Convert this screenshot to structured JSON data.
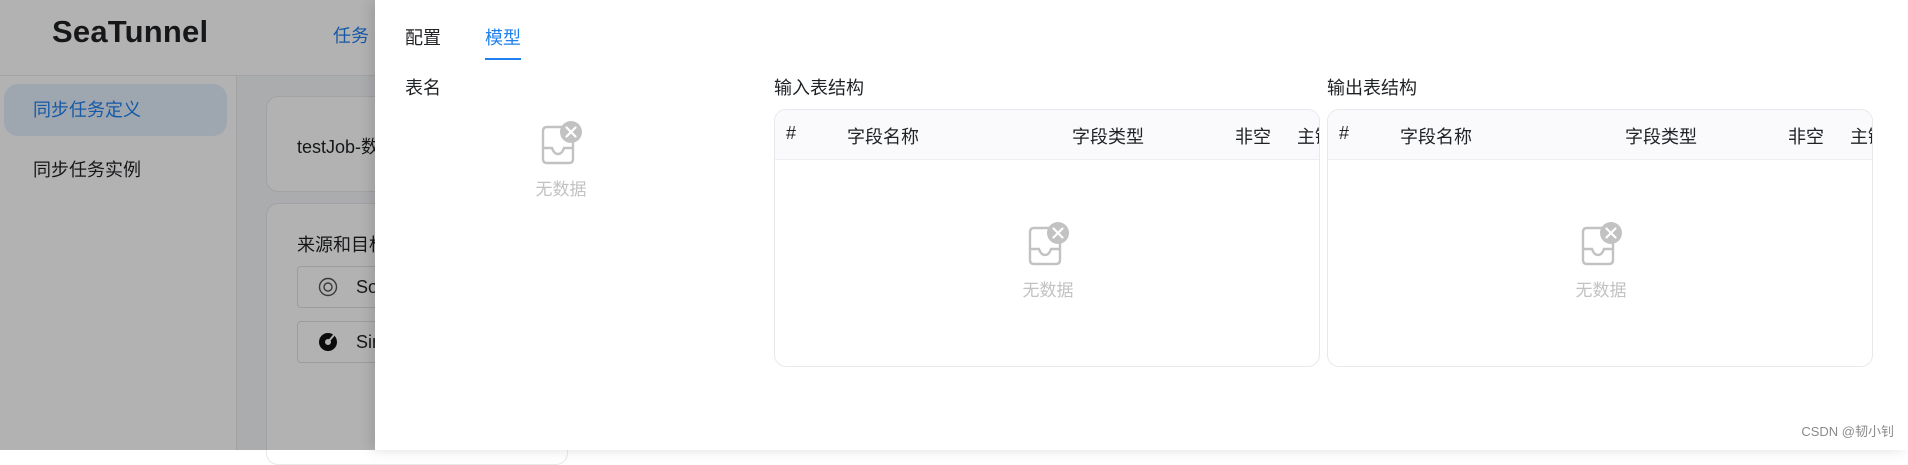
{
  "app": {
    "logo": "SeaTunnel",
    "top_nav_partial": "任务",
    "sidebar": [
      {
        "label": "同步任务定义",
        "active": true
      },
      {
        "label": "同步任务实例",
        "active": false
      }
    ],
    "job_title_partial": "testJob-数",
    "source_target_title_partial": "来源和目标",
    "nodes": [
      {
        "label_partial": "So",
        "icon": "source-ring-icon"
      },
      {
        "label_partial": "Sin",
        "icon": "sink-dial-icon"
      }
    ]
  },
  "drawer": {
    "tabs": [
      {
        "label": "配置",
        "active": false
      },
      {
        "label": "模型",
        "active": true
      }
    ],
    "table_name": {
      "label": "表名",
      "empty_text": "无数据"
    },
    "input_schema": {
      "label": "输入表结构",
      "columns": [
        "#",
        "字段名称",
        "字段类型",
        "非空",
        "主键"
      ],
      "empty_text": "无数据"
    },
    "output_schema": {
      "label": "输出表结构",
      "columns": [
        "#",
        "字段名称",
        "字段类型",
        "非空",
        "主键"
      ],
      "empty_text": "无数据"
    }
  },
  "watermark": "CSDN @韧小钊",
  "colors": {
    "accent": "#2080f0",
    "empty_gray": "#c2c2c2",
    "mask": "rgba(0,0,0,0.30)"
  }
}
